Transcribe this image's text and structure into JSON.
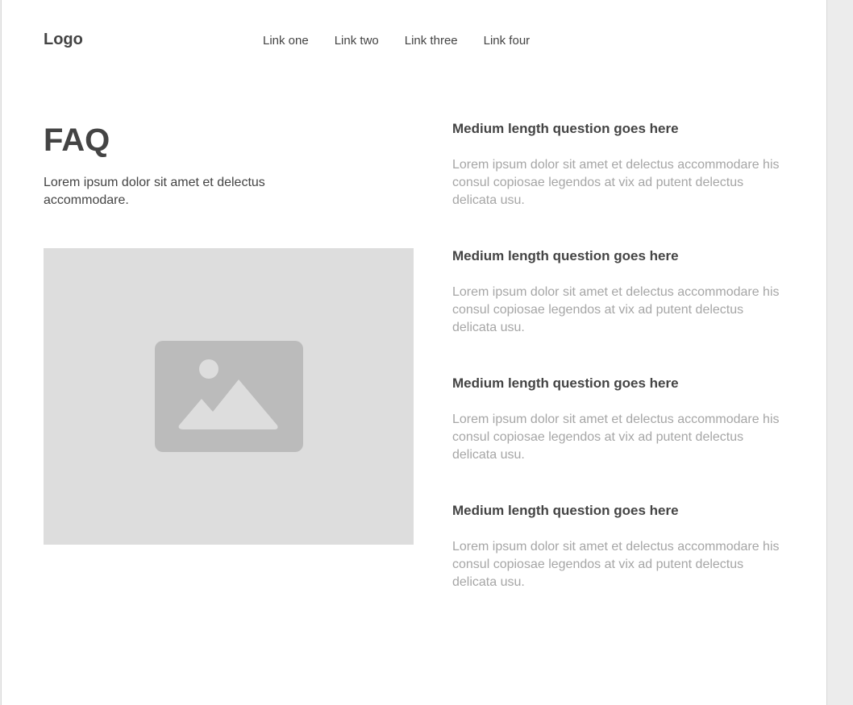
{
  "header": {
    "logo": "Logo",
    "nav": [
      "Link one",
      "Link two",
      "Link three",
      "Link four"
    ]
  },
  "intro": {
    "title": "FAQ",
    "subtitle": "Lorem ipsum dolor sit amet et delectus accommodare."
  },
  "image": {
    "icon": "image-placeholder-icon"
  },
  "faq": [
    {
      "question": "Medium length question goes here",
      "answer": "Lorem ipsum dolor sit amet et delectus accommodare his consul copiosae legendos at vix ad putent delectus delicata usu."
    },
    {
      "question": "Medium length question goes here",
      "answer": "Lorem ipsum dolor sit amet et delectus accommodare his consul copiosae legendos at vix ad putent delectus delicata usu."
    },
    {
      "question": "Medium length question goes here",
      "answer": "Lorem ipsum dolor sit amet et delectus accommodare his consul copiosae legendos at vix ad putent delectus delicata usu."
    },
    {
      "question": "Medium length question goes here",
      "answer": "Lorem ipsum dolor sit amet et delectus accommodare his consul copiosae legendos at vix ad putent delectus delicata usu."
    }
  ],
  "colors": {
    "text": "#444444",
    "muted": "#a6a6a6",
    "placeholder_bg": "#dddddd",
    "placeholder_icon": "#bbbbbb",
    "side_bg": "#ececec"
  }
}
